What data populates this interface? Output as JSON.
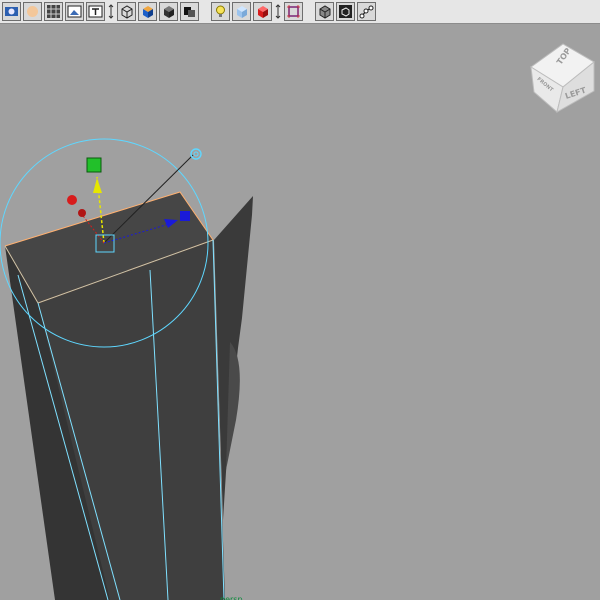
{
  "toolbar": {
    "items": [
      {
        "name": "render-view-button",
        "icon": "render-icon"
      },
      {
        "name": "shaded-sphere-button",
        "icon": "sphere-icon"
      },
      {
        "name": "grid-button",
        "icon": "grid-icon"
      },
      {
        "name": "image-plane-button",
        "icon": "image-icon"
      },
      {
        "name": "text-label-button",
        "icon": "text-icon"
      },
      {
        "name": "wireframe-cube-button",
        "icon": "wire-cube-icon"
      },
      {
        "name": "smooth-shade-button",
        "icon": "shaded-cube-icon"
      },
      {
        "name": "flat-shade-button",
        "icon": "flat-cube-icon"
      },
      {
        "name": "shadow-button",
        "icon": "shadow-icon"
      },
      {
        "name": "lights-button",
        "icon": "light-icon"
      },
      {
        "name": "xray-button",
        "icon": "xray-icon"
      },
      {
        "name": "red-material-button",
        "icon": "red-cube-icon"
      },
      {
        "name": "isolate-select-button",
        "icon": "isolate-icon"
      },
      {
        "name": "backface-button",
        "icon": "backface-icon"
      },
      {
        "name": "frame-cube-button",
        "icon": "frame-icon"
      },
      {
        "name": "joint-button",
        "icon": "joint-icon"
      }
    ]
  },
  "view_cube": {
    "top_label": "TOP",
    "left_label": "LEFT",
    "front_label": "FRONT"
  },
  "status": {
    "bottom_text": "persp"
  },
  "colors": {
    "background": "#a0a0a0",
    "mesh": "#3f3f3f",
    "selection_edge": "#7fe0ff",
    "top_edge": "#ffb070",
    "gizmo_x": "#d81c1c",
    "gizmo_y": "#22c02a",
    "gizmo_z": "#1a1ad8",
    "gizmo_yellow": "#e6e600",
    "gizmo_ring": "#5fd7ff"
  }
}
